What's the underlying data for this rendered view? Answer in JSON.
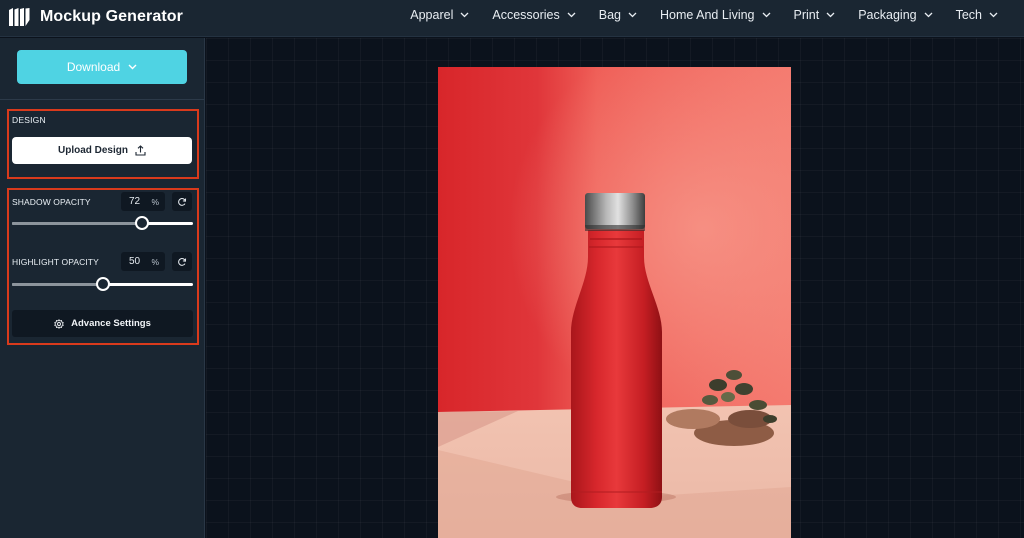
{
  "app": {
    "title": "Mockup Generator",
    "logo_icon": "brand-logo-icon"
  },
  "nav": {
    "items": [
      {
        "label": "Apparel",
        "icon": "chevron-down-icon"
      },
      {
        "label": "Accessories",
        "icon": "chevron-down-icon"
      },
      {
        "label": "Bag",
        "icon": "chevron-down-icon"
      },
      {
        "label": "Home And Living",
        "icon": "chevron-down-icon"
      },
      {
        "label": "Print",
        "icon": "chevron-down-icon"
      },
      {
        "label": "Packaging",
        "icon": "chevron-down-icon"
      },
      {
        "label": "Tech",
        "icon": "chevron-down-icon"
      }
    ]
  },
  "sidebar": {
    "download_label": "Download",
    "design": {
      "section_label": "DESIGN",
      "upload_label": "Upload Design",
      "upload_icon": "upload-icon"
    },
    "shadow": {
      "label": "SHADOW OPACITY",
      "value": "72",
      "unit": "%",
      "level": 0.72,
      "reset_icon": "refresh-icon"
    },
    "highlight": {
      "label": "HIGHLIGHT OPACITY",
      "value": "50",
      "unit": "%",
      "level": 0.5,
      "reset_icon": "refresh-icon"
    },
    "advance_label": "Advance Settings",
    "advance_icon": "gear-icon"
  },
  "mockup": {
    "subject": "red-water-bottle-photo"
  },
  "colors": {
    "topbar_bg": "#1a2632",
    "canvas_bg": "#0b121c",
    "accent_cyan": "#4fd3e3",
    "panel_outline": "#d93a1c",
    "bottle_red": "#dc2a2c",
    "wall_salmon": "#f0665e"
  }
}
